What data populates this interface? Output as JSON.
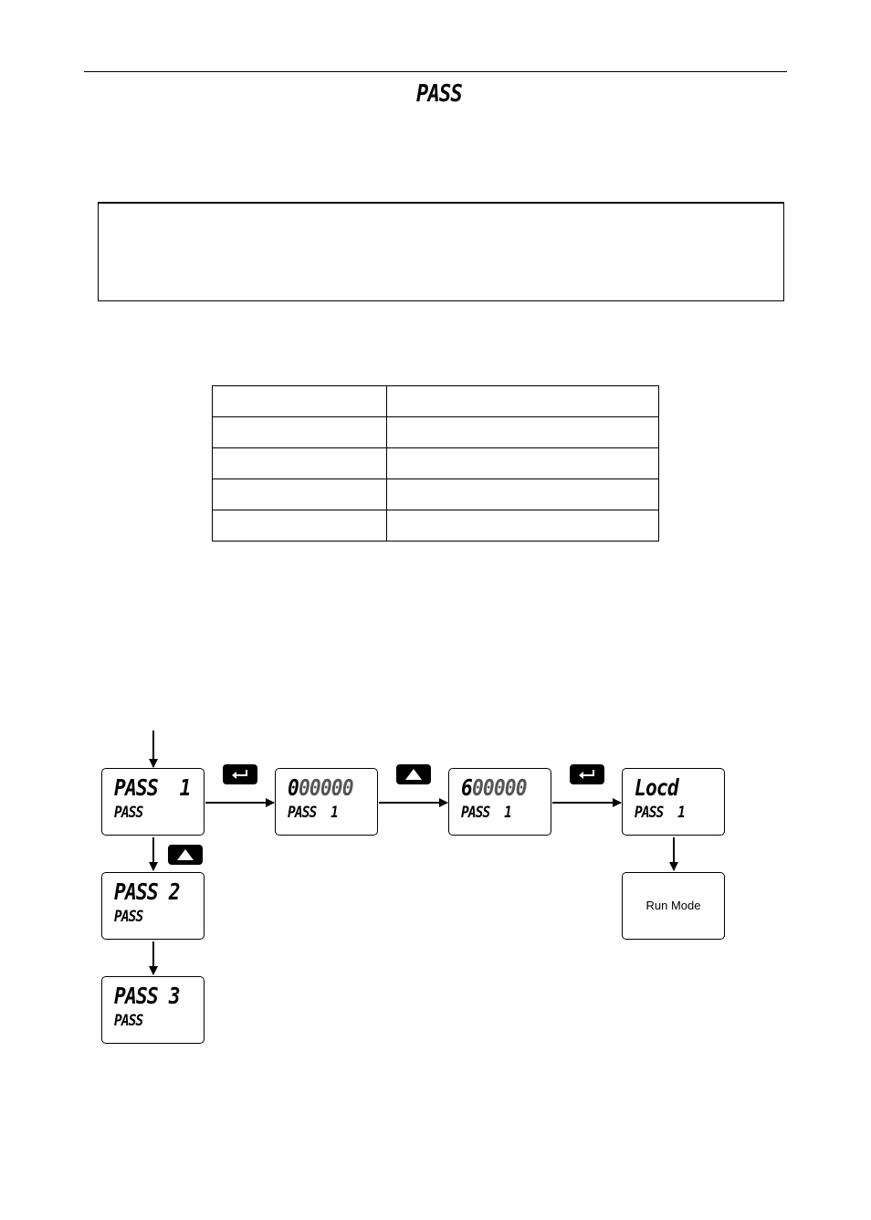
{
  "header": {
    "title": "PASS"
  },
  "note_box": {
    "text": ""
  },
  "param_table": {
    "rows": [
      [
        "",
        ""
      ],
      [
        "",
        ""
      ],
      [
        "",
        ""
      ],
      [
        "",
        ""
      ],
      [
        "",
        ""
      ]
    ]
  },
  "diagram": {
    "boxes": {
      "pass1": {
        "line1": "PASS  1",
        "line2": "PASS"
      },
      "zero": {
        "line1_active": "0",
        "line1_dim": "00000",
        "line2": "PASS  1"
      },
      "six": {
        "line1_active": "6",
        "line1_dim": "00000",
        "line2": "PASS  1"
      },
      "locd": {
        "line1": "Locd",
        "line2": "PASS  1"
      },
      "run_mode": {
        "label": "Run Mode"
      },
      "pass2": {
        "line1": "PASS 2",
        "line2": "PASS"
      },
      "pass3": {
        "line1": "PASS 3",
        "line2": "PASS"
      }
    },
    "keys": {
      "enter_1": "enter-key",
      "up_1": "up-key",
      "enter_2": "enter-key",
      "up_2": "up-key"
    }
  }
}
